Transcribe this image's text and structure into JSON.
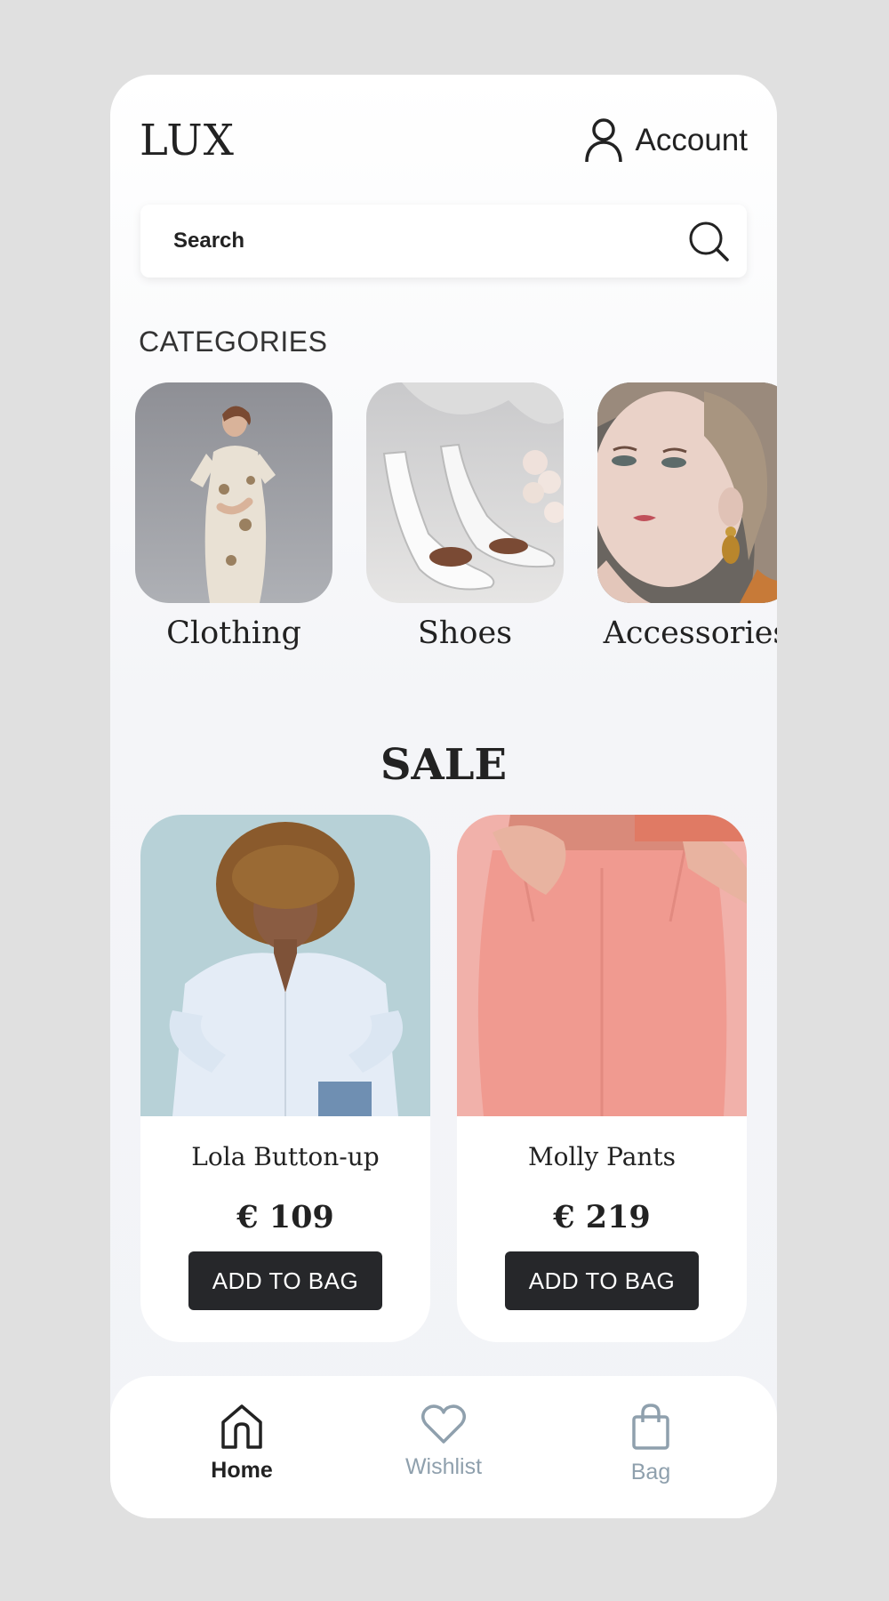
{
  "header": {
    "logo": "LUX",
    "account_label": "Account"
  },
  "search": {
    "placeholder": "Search"
  },
  "categories": {
    "title": "CATEGORIES",
    "items": [
      {
        "label": "Clothing"
      },
      {
        "label": "Shoes"
      },
      {
        "label": "Accessories"
      }
    ]
  },
  "sale": {
    "title": "SALE",
    "products": [
      {
        "name": "Lola Button-up",
        "price": "€ 109",
        "button": "ADD TO BAG"
      },
      {
        "name": "Molly Pants",
        "price": "€ 219",
        "button": "ADD TO BAG"
      }
    ]
  },
  "bottom_nav": {
    "items": [
      {
        "label": "Home",
        "icon": "home-icon",
        "active": true
      },
      {
        "label": "Wishlist",
        "icon": "heart-icon",
        "active": false
      },
      {
        "label": "Bag",
        "icon": "bag-icon",
        "active": false
      }
    ]
  },
  "colors": {
    "background": "#e0e0e0",
    "button": "#26272a",
    "nav_inactive": "#8fa0ad",
    "nav_active": "#222222"
  }
}
